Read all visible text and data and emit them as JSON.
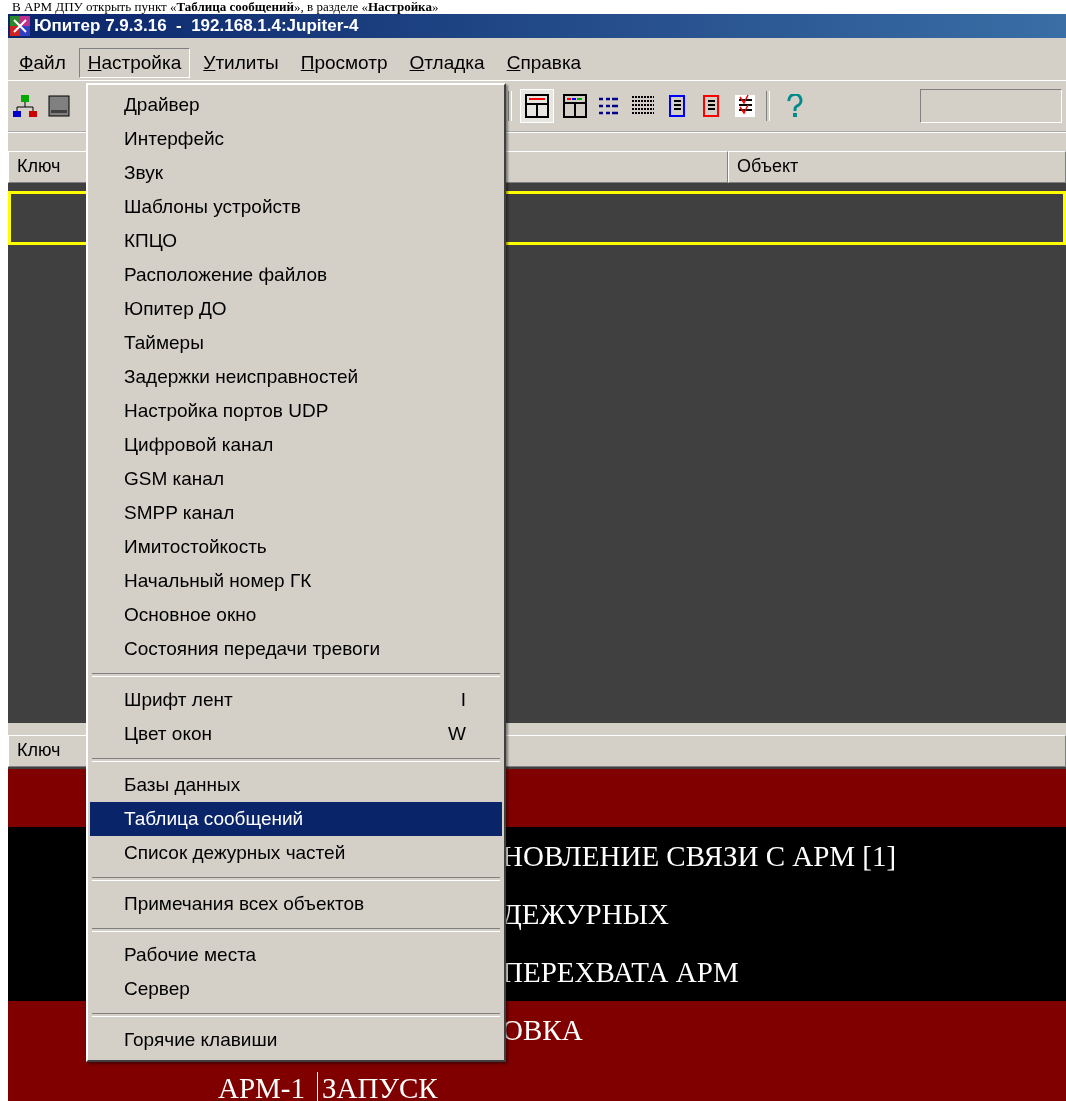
{
  "caption": "В АРМ ДПУ открыть пункт «**Таблица сообщений**», в разделе «**Настройка**»",
  "window": {
    "title": "Юпитер 7.9.3.16  -  192.168.1.4:Jupiter-4"
  },
  "menubar": [
    {
      "label": "Файл",
      "open": false
    },
    {
      "label": "Настройка",
      "open": true
    },
    {
      "label": "Утилиты",
      "open": false
    },
    {
      "label": "Просмотр",
      "open": false
    },
    {
      "label": "Отладка",
      "open": false
    },
    {
      "label": "Справка",
      "open": false
    }
  ],
  "toolbar": {
    "layout_pressed": true
  },
  "upper_table": {
    "columns": [
      "Ключ",
      "Объект"
    ],
    "focus_frame": true
  },
  "lower_table": {
    "columns": [
      "Ключ"
    ],
    "rows": [
      {
        "color": "#800000"
      },
      {
        "color": "#000000",
        "column_2": "НОВЛЕНИЕ СВЯЗИ С АРМ [1]"
      },
      {
        "color": "#000000",
        "column_2": "ДЕЖУРНЫХ"
      },
      {
        "color": "#000000",
        "column_2": "ПЕРЕХВАТА АРМ"
      },
      {
        "color": "#800000",
        "column_2": "ОВКА"
      },
      {
        "color": "#800000",
        "column_1": "АРМ-1",
        "column_2": "ЗАПУСК"
      }
    ]
  },
  "menu": [
    {
      "kind": "item",
      "label": "Драйвер",
      "selected": false
    },
    {
      "kind": "item",
      "label": "Интерфейс",
      "selected": false
    },
    {
      "kind": "item",
      "label": "Звук",
      "selected": false
    },
    {
      "kind": "item",
      "label": "Шаблоны устройств",
      "selected": false
    },
    {
      "kind": "item",
      "label": "КПЦО",
      "selected": false
    },
    {
      "kind": "item",
      "label": "Расположение файлов",
      "selected": false
    },
    {
      "kind": "item",
      "label": "Юпитер ДО",
      "selected": false
    },
    {
      "kind": "item",
      "label": "Таймеры",
      "selected": false
    },
    {
      "kind": "item",
      "label": "Задержки неисправностей",
      "selected": false
    },
    {
      "kind": "item",
      "label": "Настройка портов UDP",
      "selected": false
    },
    {
      "kind": "item",
      "label": "Цифровой канал",
      "selected": false
    },
    {
      "kind": "item",
      "label": "GSM канал",
      "selected": false
    },
    {
      "kind": "item",
      "label": "SMPP канал",
      "selected": false
    },
    {
      "kind": "item",
      "label": "Имитостойкость",
      "selected": false
    },
    {
      "kind": "item",
      "label": "Начальный номер ГК",
      "selected": false
    },
    {
      "kind": "item",
      "label": "Основное окно",
      "selected": false
    },
    {
      "kind": "item",
      "label": "Состояния передачи тревоги",
      "selected": false
    },
    {
      "kind": "separator"
    },
    {
      "kind": "item",
      "label": "Шрифт лент",
      "shortcut": "I",
      "selected": false
    },
    {
      "kind": "item",
      "label": "Цвет окон",
      "shortcut": "W",
      "selected": false
    },
    {
      "kind": "separator"
    },
    {
      "kind": "item",
      "label": "Базы данных",
      "selected": false
    },
    {
      "kind": "item",
      "label": "Таблица сообщений",
      "selected": true
    },
    {
      "kind": "item",
      "label": "Список дежурных частей",
      "selected": false
    },
    {
      "kind": "separator"
    },
    {
      "kind": "item",
      "label": "Примечания всех объектов",
      "selected": false
    },
    {
      "kind": "separator"
    },
    {
      "kind": "item",
      "label": "Рабочие места",
      "selected": false
    },
    {
      "kind": "item",
      "label": "Сервер",
      "selected": false
    },
    {
      "kind": "separator"
    },
    {
      "kind": "item",
      "label": "Горячие клавиши",
      "selected": false
    }
  ]
}
